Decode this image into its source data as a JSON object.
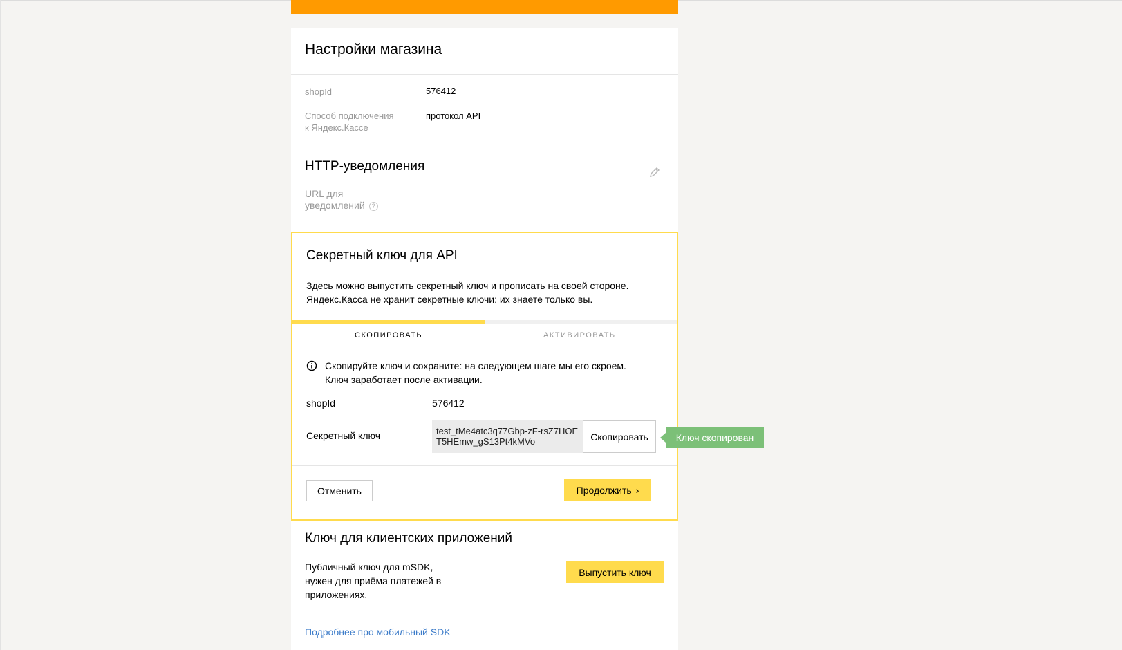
{
  "settings": {
    "title": "Настройки магазина",
    "shop_id_label": "shopId",
    "shop_id_value": "576412",
    "connection_label_line1": "Способ подключения",
    "connection_label_line2": "к Яндекс.Кассе",
    "connection_value": "протокол API"
  },
  "http_notifications": {
    "title": "HTTP-уведомления",
    "url_label_line1": "URL для",
    "url_label_line2": "уведомлений",
    "help_glyph": "?",
    "edit_icon": "pencil-icon"
  },
  "api_key": {
    "title": "Секретный ключ для API",
    "description": "Здесь можно выпустить секретный ключ и прописать на своей стороне. Яндекс.Касса не хранит секретные ключи: их знаете только вы.",
    "progress": 0.5,
    "steps": [
      "СКОПИРОВАТЬ",
      "АКТИВИРОВАТЬ"
    ],
    "notice": "Скопируйте ключ и сохраните: на следующем шаге мы его скроем. Ключ заработает после активации.",
    "shop_id_label": "shopId",
    "shop_id_value": "576412",
    "secret_label": "Секретный ключ",
    "secret_value": "test_tMe4atc3q77Gbp-zF-rsZ7HOET5HEmw_gS13Pt4kMVo",
    "copy_label": "Скопировать",
    "cancel_label": "Отменить",
    "continue_label": "Продолжить",
    "continue_glyph": "›",
    "copied_tooltip": "Ключ скопирован"
  },
  "client_key": {
    "title": "Ключ для клиентских приложений",
    "description": "Публичный ключ для mSDK, нужен для приёма платежей в приложениях.",
    "issue_label": "Выпустить ключ",
    "link_label": "Подробнее про мобильный SDK"
  },
  "colors": {
    "accent_yellow": "#ffdb4d",
    "top_orange": "#ff9a00",
    "tooltip_green": "#7cc078",
    "link_blue": "#3d7cc9"
  }
}
